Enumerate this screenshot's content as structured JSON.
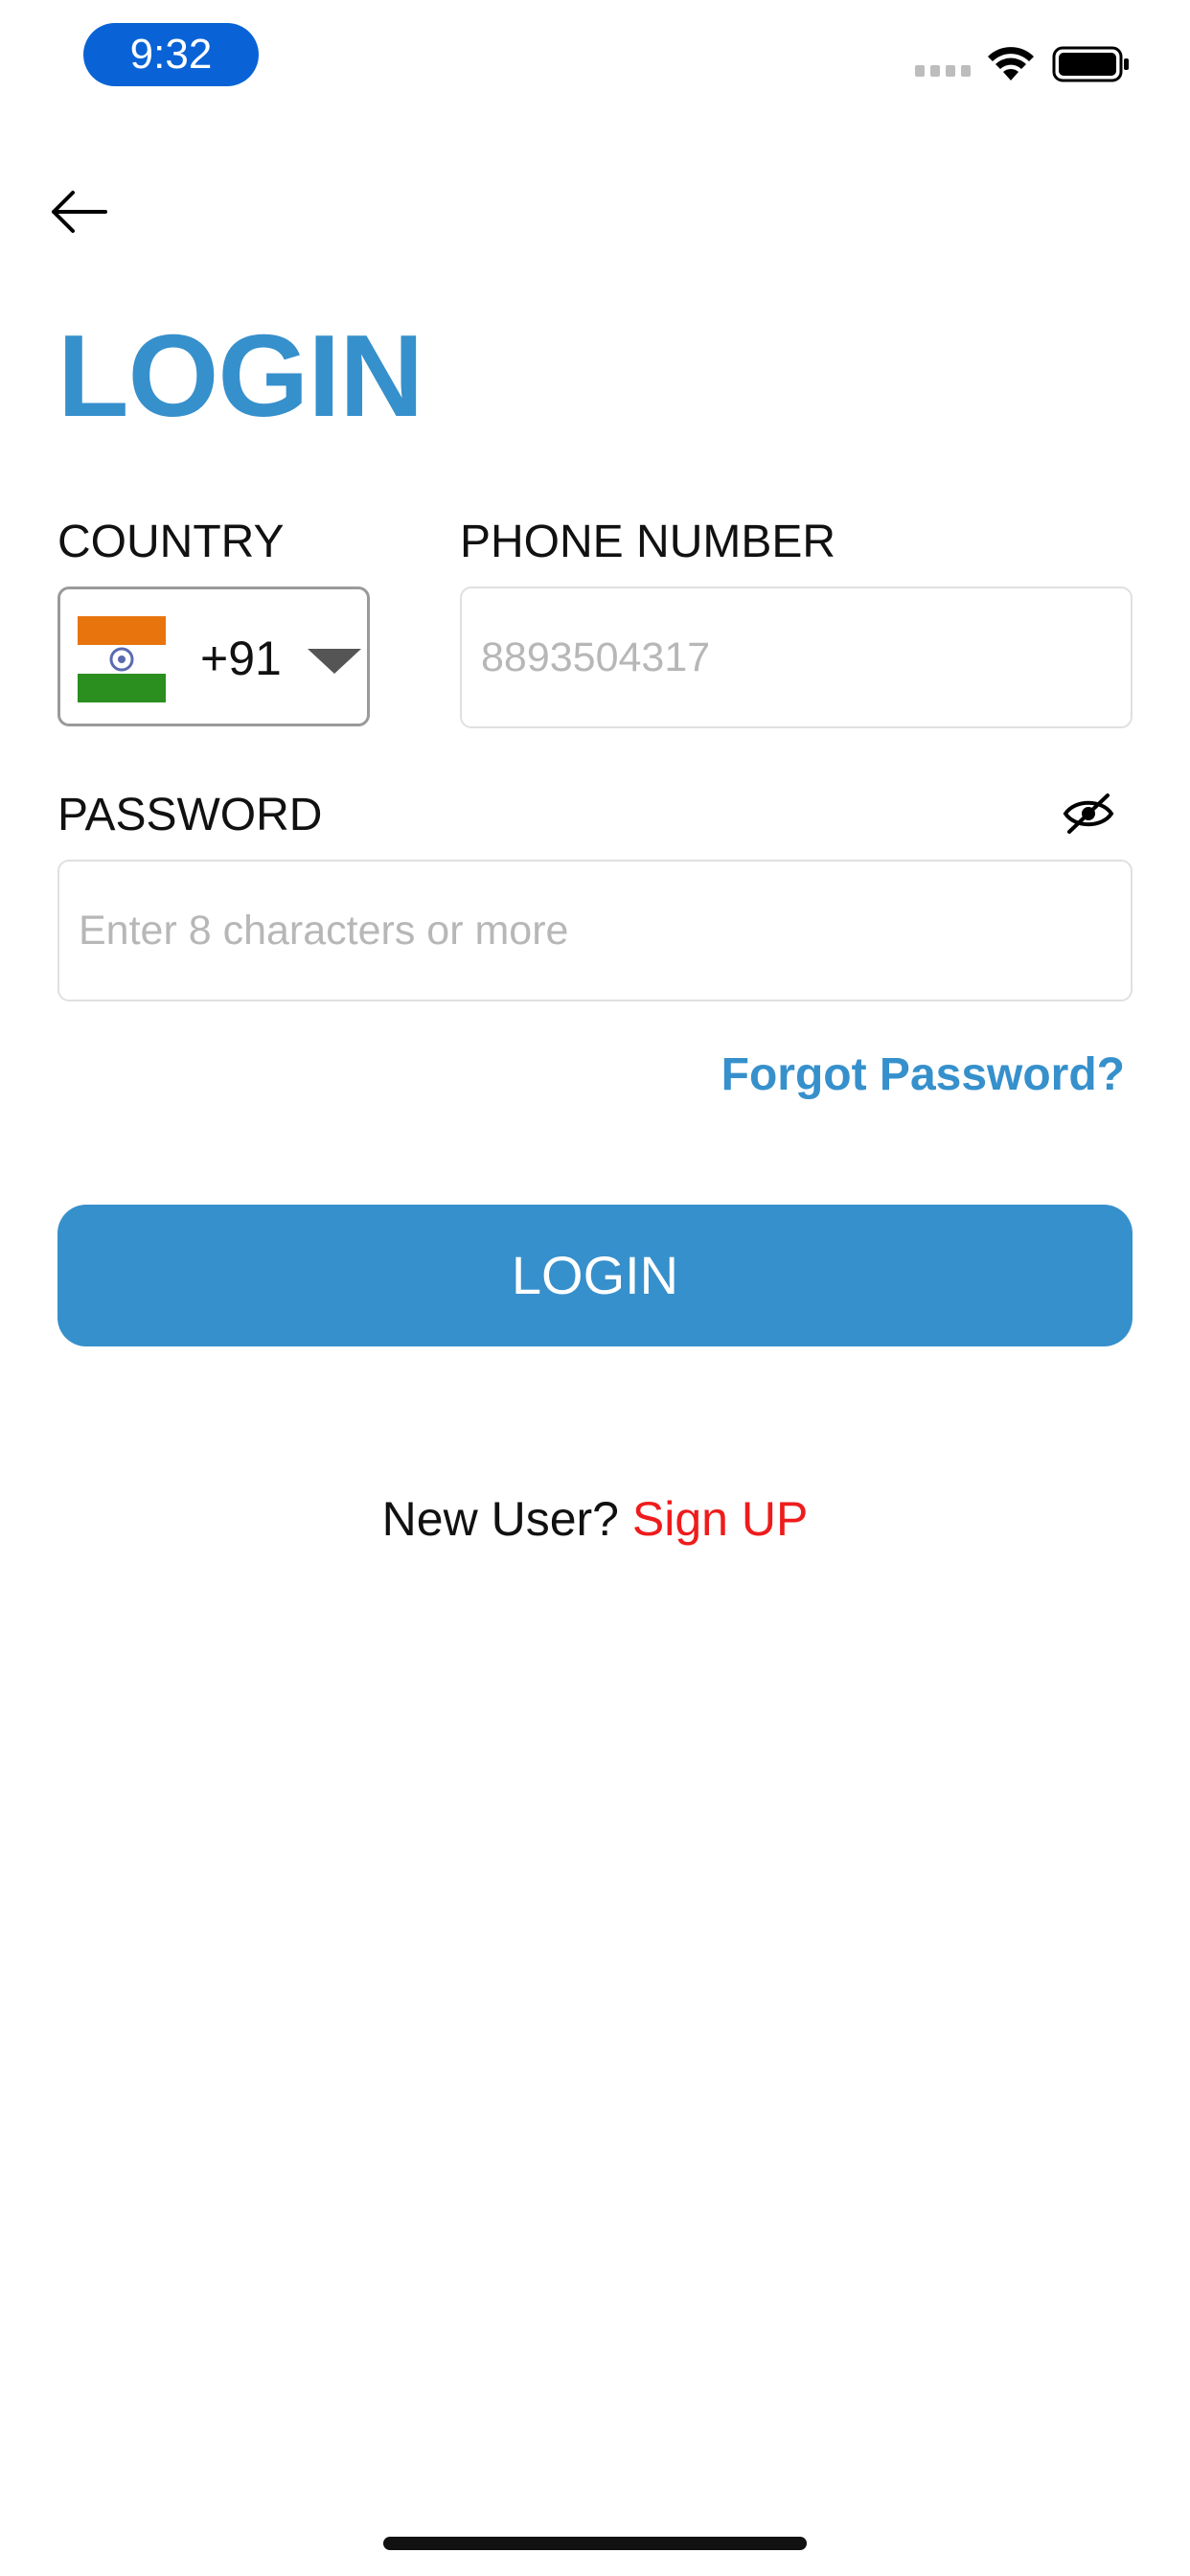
{
  "status_bar": {
    "time": "9:32"
  },
  "page": {
    "title": "LOGIN"
  },
  "country": {
    "label": "COUNTRY",
    "dial_code": "+91",
    "flag": "india-flag-icon"
  },
  "phone": {
    "label": "PHONE NUMBER",
    "placeholder": "8893504317",
    "value": ""
  },
  "password": {
    "label": "PASSWORD",
    "placeholder": "Enter 8 characters or more",
    "value": "",
    "toggle_icon": "eye-slash-icon"
  },
  "links": {
    "forgot_password": "Forgot Password?"
  },
  "buttons": {
    "login": "LOGIN"
  },
  "signup": {
    "prompt": "New User?",
    "link": "Sign UP"
  },
  "colors": {
    "primary": "#3690cc",
    "link_red": "#ee1c1c",
    "time_pill": "#0a63d6"
  }
}
